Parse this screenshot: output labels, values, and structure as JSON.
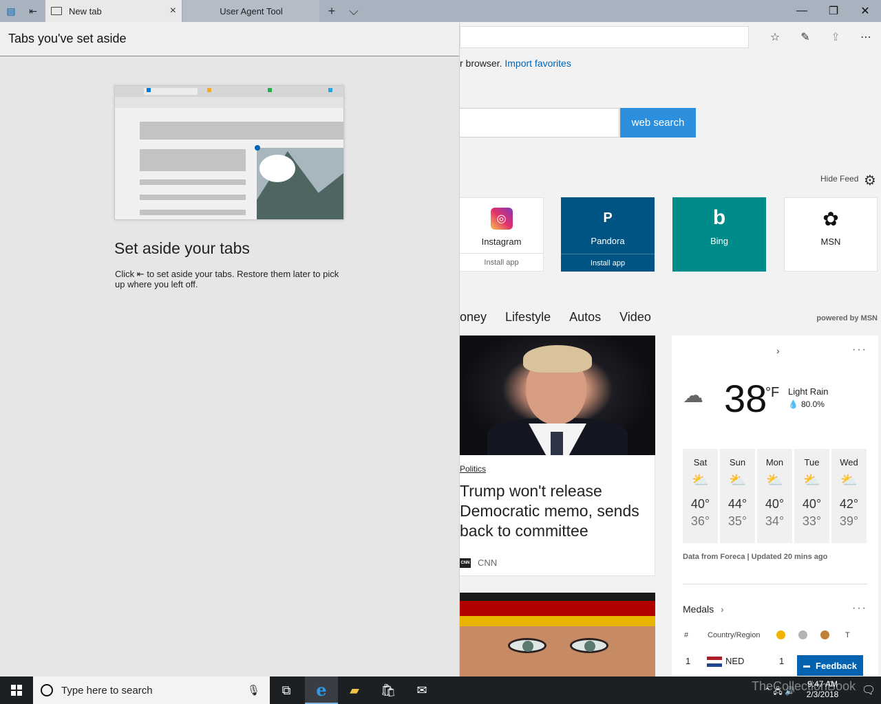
{
  "titlebar": {
    "tabs": [
      {
        "label": "New tab",
        "close": "×"
      },
      {
        "label": "User Agent Tool"
      }
    ],
    "new_tab_glyph": "+",
    "tab_list_glyph": "⌵",
    "window": {
      "minimize": "—",
      "restore": "❐",
      "close": "✕"
    }
  },
  "toolbar": {
    "icons": [
      "favorites-icon",
      "pen-icon",
      "share-icon",
      "more-icon"
    ],
    "more_glyph": "⋯"
  },
  "import": {
    "text": "r browser.",
    "link": "Import favorites"
  },
  "search": {
    "button": "web search"
  },
  "feed": {
    "hide_label": "Hide Feed"
  },
  "tiles": [
    {
      "name": "Instagram",
      "sub": "Install app",
      "glyph": "◎"
    },
    {
      "name": "Pandora",
      "sub": "Install app",
      "glyph": "P"
    },
    {
      "name": "Bing",
      "glyph": "b"
    },
    {
      "name": "MSN",
      "glyph": "✿"
    }
  ],
  "categories": [
    "oney",
    "Lifestyle",
    "Autos",
    "Video"
  ],
  "powered_by": "powered by MSN",
  "news": {
    "tag": "Politics",
    "title": "Trump won't release Democratic memo, sends back to committee",
    "source": "CNN",
    "source_logo": "CNN"
  },
  "weather": {
    "temp": "38",
    "unit": "°F",
    "condition": "Light Rain",
    "precip": "80.0%",
    "days": [
      {
        "name": "Sat",
        "hi": "40°",
        "lo": "36°"
      },
      {
        "name": "Sun",
        "hi": "44°",
        "lo": "35°"
      },
      {
        "name": "Mon",
        "hi": "40°",
        "lo": "34°"
      },
      {
        "name": "Tue",
        "hi": "40°",
        "lo": "33°"
      },
      {
        "name": "Wed",
        "hi": "42°",
        "lo": "39°"
      }
    ],
    "source": "Data from Foreca | Updated 20 mins ago",
    "more": "···",
    "chevron": "›"
  },
  "medals": {
    "title": "Medals",
    "chevron": "›",
    "more": "···",
    "headers": {
      "rank": "#",
      "country": "Country/Region",
      "total": "T"
    },
    "colors": {
      "gold": "#f0b400",
      "silver": "#b4b4b4",
      "bronze": "#c0803a"
    },
    "row": {
      "rank": "1",
      "country": "NED",
      "gold": "1"
    }
  },
  "feedback": {
    "label": "Feedback",
    "glyph": "▬"
  },
  "set_aside": {
    "header": "Tabs you've set aside",
    "title": "Set aside your tabs",
    "desc_before": "Click",
    "desc_after": "to set aside your tabs. Restore them later to pick up where you left off."
  },
  "taskbar": {
    "search_placeholder": "Type here to search",
    "time": "9:47 AM",
    "date": "2/3/2018",
    "watermark": "TheCollectionBook"
  }
}
